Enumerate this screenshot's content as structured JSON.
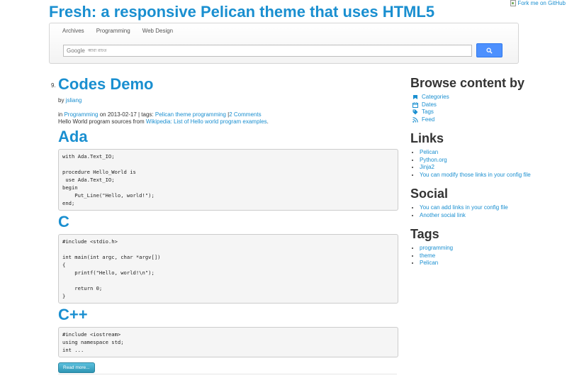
{
  "header": {
    "site_title": "Fresh: a responsive Pelican theme that uses HTML5",
    "fork_ribbon_alt": "Fork me on GitHub"
  },
  "nav": {
    "items": [
      {
        "label": "Archives"
      },
      {
        "label": "Programming"
      },
      {
        "label": "Web Design"
      }
    ],
    "search": {
      "brand": "Google",
      "placeholder": "ব্বারা রচিত",
      "button_icon": "search-icon"
    }
  },
  "post": {
    "number": "9.",
    "title": "Codes Demo",
    "by_prefix": "by",
    "author": "jsliang",
    "meta_in": "in",
    "category": "Programming",
    "meta_date": "on 2013-02-17 | tags:",
    "tags_text": "Pelican theme programming",
    "separator": "|",
    "comments": "2 Comments",
    "summary_prefix": "Hello World program sources from",
    "summary_link": "Wikipedia: List of Hello world program examples",
    "summary_suffix": ".",
    "sections": [
      {
        "heading": "Ada",
        "code": "with Ada.Text_IO;\n\nprocedure Hello_World is\n use Ada.Text_IO;\nbegin\n    Put_Line(\"Hello, world!\");\nend;"
      },
      {
        "heading": "C",
        "code": "#include <stdio.h>\n\nint main(int argc, char *argv[])\n{\n    printf(\"Hello, world!\\n\");\n\n    return 0;\n}"
      },
      {
        "heading": "C++",
        "code": "#include <iostream>\nusing namespace std;\nint ..."
      }
    ],
    "read_more": "Read more..."
  },
  "sidebar": {
    "browse": {
      "heading": "Browse content by",
      "items": [
        {
          "label": "Categories",
          "icon": "bookmark-icon"
        },
        {
          "label": "Dates",
          "icon": "calendar-icon"
        },
        {
          "label": "Tags",
          "icon": "tag-icon"
        },
        {
          "label": "Feed",
          "icon": "rss-icon"
        }
      ]
    },
    "links": {
      "heading": "Links",
      "items": [
        {
          "label": "Pelican"
        },
        {
          "label": "Python.org"
        },
        {
          "label": "Jinja2"
        },
        {
          "label": "You can modify those links in your config file"
        }
      ]
    },
    "social": {
      "heading": "Social",
      "items": [
        {
          "label": "You can add links in your config file"
        },
        {
          "label": "Another social link"
        }
      ]
    },
    "tags": {
      "heading": "Tags",
      "items": [
        {
          "label": "programming"
        },
        {
          "label": "theme"
        },
        {
          "label": "Pelican"
        }
      ]
    }
  },
  "colors": {
    "link": "#1a8fd0",
    "search_button": "#4d90fe",
    "read_more_button": "#2f96b4"
  }
}
